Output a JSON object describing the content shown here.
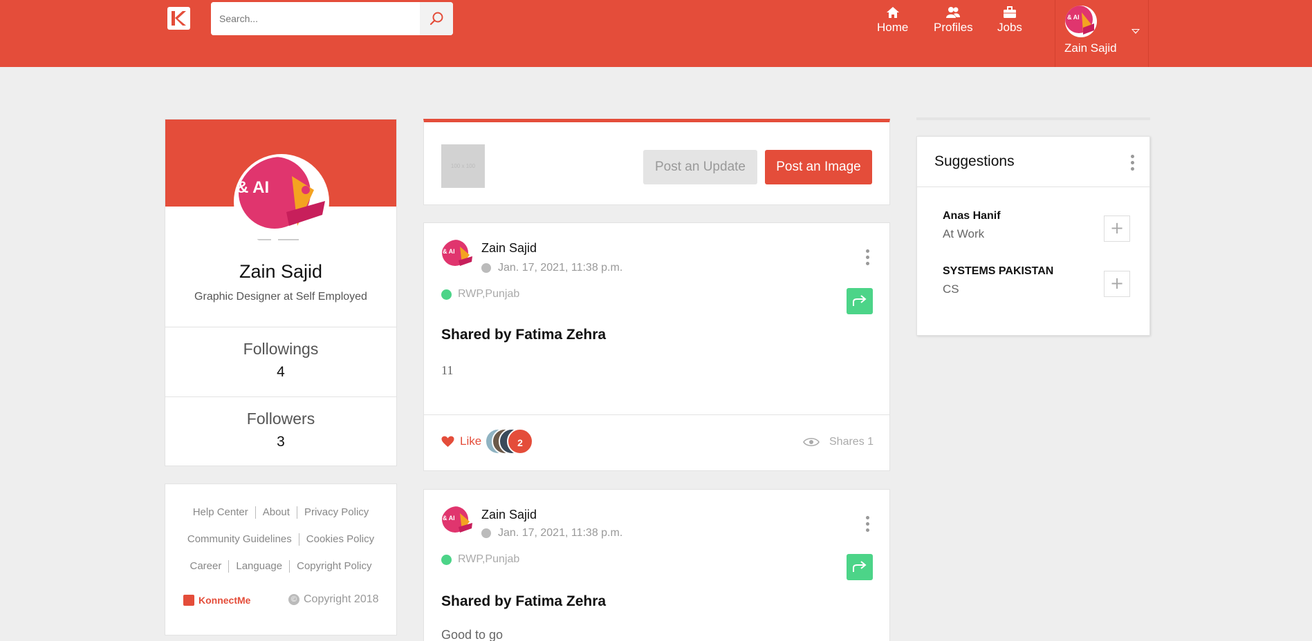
{
  "header": {
    "logo_icon": "konnectme-logo-icon",
    "search": {
      "placeholder": "Search...",
      "value": ""
    },
    "nav": [
      {
        "label": "Home",
        "icon": "home-icon"
      },
      {
        "label": "Profiles",
        "icon": "users-icon"
      },
      {
        "label": "Jobs",
        "icon": "briefcase-icon"
      }
    ],
    "user": {
      "name": "Zain Sajid"
    },
    "accent": "#e44d3a"
  },
  "profile": {
    "name": "Zain Sajid",
    "headline": "Graphic Designer at Self Employed",
    "avatar_text": "& AI",
    "followings_label": "Followings",
    "followings_count": "4",
    "followers_label": "Followers",
    "followers_count": "3"
  },
  "footer": {
    "links_row1": [
      "Help Center",
      "About",
      "Privacy Policy"
    ],
    "links_row2": [
      "Community Guidelines",
      "Cookies Policy"
    ],
    "links_row3": [
      "Career",
      "Language",
      "Copyright Policy"
    ],
    "brand": "KonnectMe",
    "copyright": "Copyright 2018"
  },
  "composer": {
    "placeholder_image_text": "100 x 100",
    "update_label": "Post an Update",
    "image_label": "Post an Image"
  },
  "posts": [
    {
      "author": "Zain Sajid",
      "time": "Jan. 17, 2021, 11:38 p.m.",
      "location": "RWP,Punjab",
      "heading": "Shared by Fatima Zehra",
      "body": "11",
      "like_label": "Like",
      "like_count": "2",
      "shares_label": "Shares 1"
    },
    {
      "author": "Zain Sajid",
      "time": "Jan. 17, 2021, 11:38 p.m.",
      "location": "RWP,Punjab",
      "heading": "Shared by Fatima Zehra",
      "body": "Good to go"
    }
  ],
  "suggestions": {
    "title": "Suggestions",
    "items": [
      {
        "name": "Anas Hanif",
        "subtitle": "At Work"
      },
      {
        "name": "SYSTEMS PAKISTAN",
        "subtitle": "CS"
      }
    ]
  }
}
